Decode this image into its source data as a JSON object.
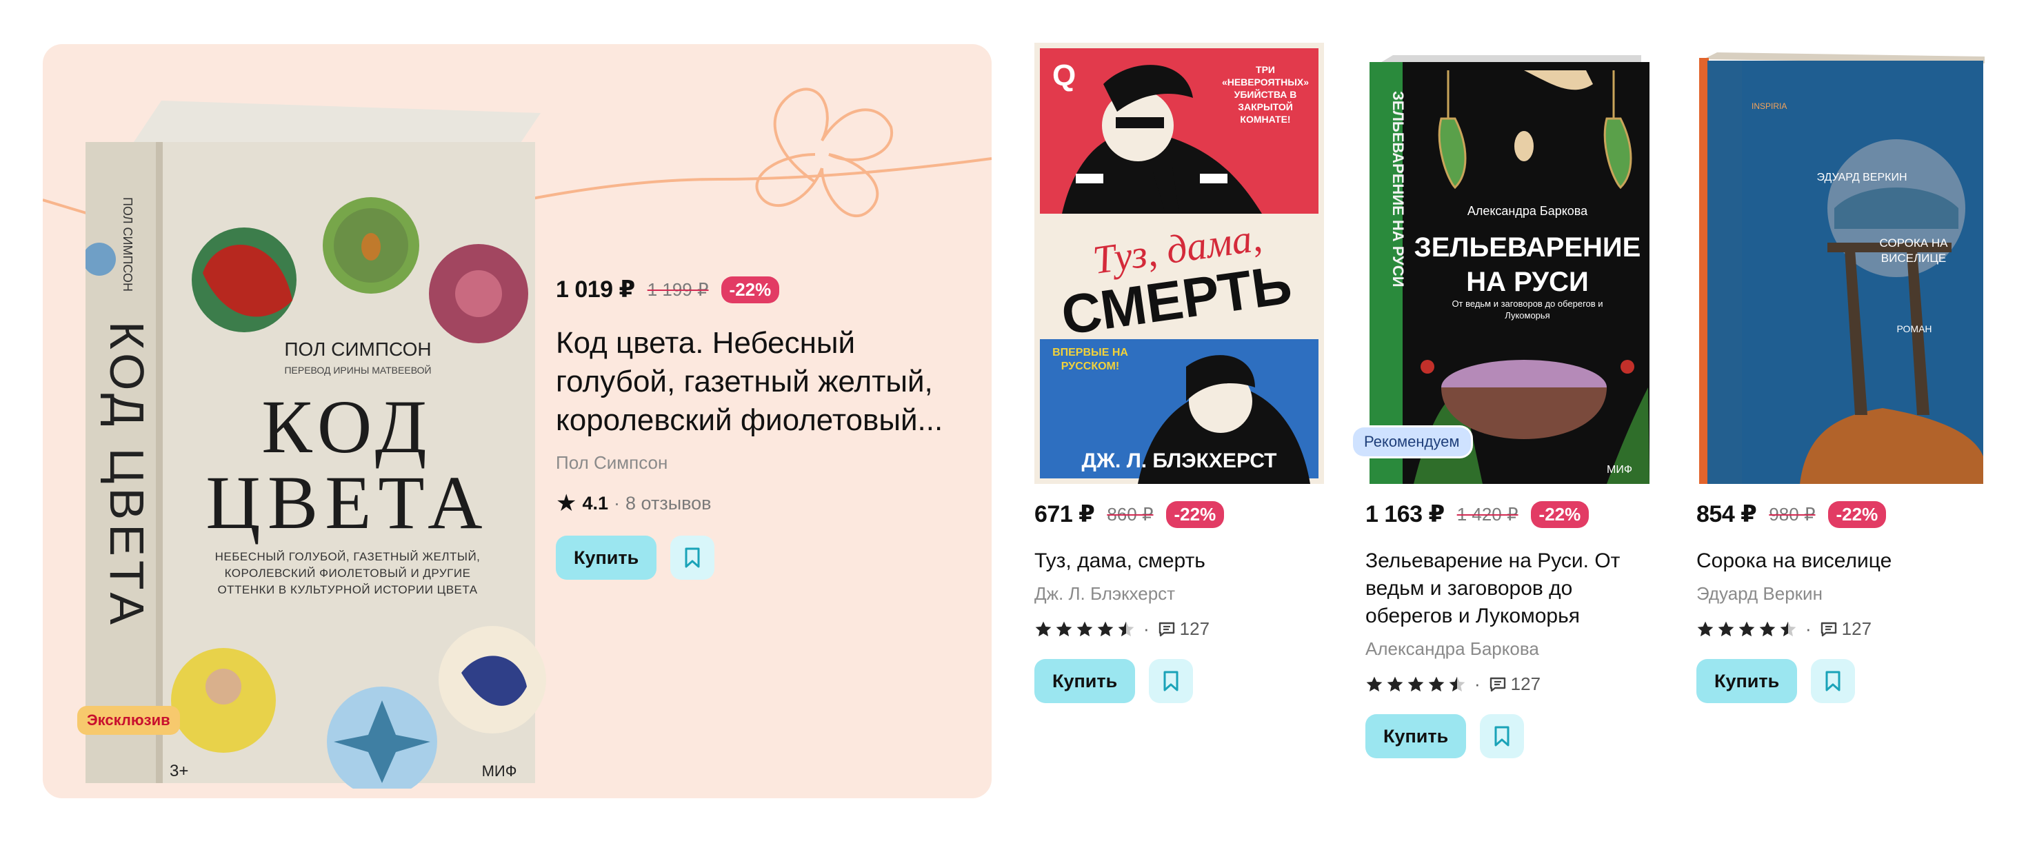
{
  "featured": {
    "badge": "Эксклюзив",
    "price": "1 019 ₽",
    "old_price": "1 199 ₽",
    "discount": "-22%",
    "title": "Код цвета. Небесный голубой, газетный желтый, королевский фиолетовый...",
    "author": "Пол Симпсон",
    "rating": "4.1",
    "reviews": "8 отзывов",
    "buy_label": "Купить",
    "cover": {
      "author": "ПОЛ СИМПСОН",
      "translator": "ПЕРЕВОД ИРИНЫ МАТВЕЕВОЙ",
      "title_line1": "КОД",
      "title_line2": "ЦВЕТА",
      "subtitle": "НЕБЕСНЫЙ ГОЛУБОЙ, ГАЗЕТНЫЙ ЖЕЛТЫЙ, КОРОЛЕВСКИЙ ФИОЛЕТОВЫЙ И ДРУГИЕ ОТТЕНКИ В КУЛЬТУРНОЙ ИСТОРИИ ЦВЕТА",
      "spine_author": "ПОЛ СИМПСОН",
      "spine_title": "КОД ЦВЕТА",
      "publisher": "МИФ",
      "age": "3+"
    }
  },
  "cards": [
    {
      "price": "671 ₽",
      "old_price": "860 ₽",
      "discount": "-22%",
      "title": "Туз, дама, смерть",
      "author": "Дж. Л. Блэкхерст",
      "rating_stars": 4.5,
      "reviews": "127",
      "buy_label": "Купить",
      "cover": {
        "tagline": "ТРИ «НЕВЕРОЯТНЫХ» УБИЙСТВА В ЗАКРЫТОЙ КОМНАТЕ!",
        "title_script": "Туз, дама,",
        "title_main": "СМЕРТЬ",
        "first_time": "ВПЕРВЫЕ НА РУССКОМ!",
        "author": "ДЖ. Л. БЛЭКХЕРСТ",
        "corner_q": "Q"
      }
    },
    {
      "badge": "Рекомендуем",
      "price": "1 163 ₽",
      "old_price": "1 420 ₽",
      "discount": "-22%",
      "title": "Зельеварение на Руси. От ведьм и заговоров до оберегов и Лукоморья",
      "author": "Александра Баркова",
      "rating_stars": 4.5,
      "reviews": "127",
      "buy_label": "Купить",
      "cover": {
        "author": "Александра Баркова",
        "title_line1": "ЗЕЛЬЕВАРЕНИЕ",
        "title_line2": "НА РУСИ",
        "subtitle": "От ведьм и заговоров до оберегов и Лукоморья",
        "spine": "ЗЕЛЬЕВАРЕНИЕ НА РУСИ",
        "publisher": "МИФ"
      }
    },
    {
      "price": "854 ₽",
      "old_price": "980 ₽",
      "discount": "-22%",
      "title": "Сорока на виселице",
      "author": "Эдуард Веркин",
      "rating_stars": 4.5,
      "reviews": "127",
      "buy_label": "Купить",
      "cover": {
        "imprint": "INSPIRIA",
        "author": "ЭДУАРД ВЕРКИН",
        "title": "СОРОКА НА ВИСЕЛИЦЕ",
        "genre": "РОМАН"
      }
    }
  ],
  "colors": {
    "featured_bg": "#fce8de",
    "discount": "#e23b64",
    "buy_button": "#9be6f0",
    "fav_button": "#d8f6fa"
  }
}
